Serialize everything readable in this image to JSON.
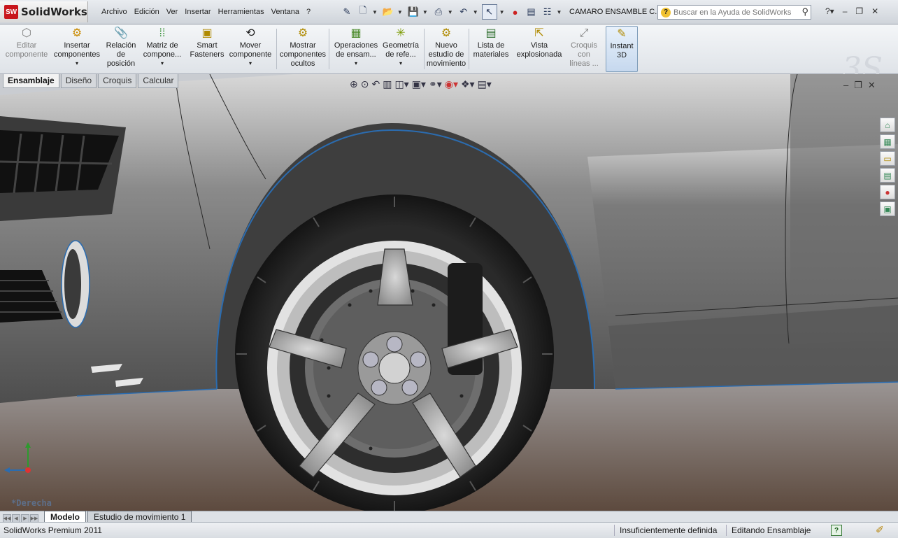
{
  "app": {
    "logo_text_prefix": "SW",
    "logo_text": "SolidWorks",
    "document_title": "CAMARO ENSAMBLE C..."
  },
  "menu": [
    "Archivo",
    "Edición",
    "Ver",
    "Insertar",
    "Herramientas",
    "Ventana",
    "?"
  ],
  "search": {
    "placeholder": "Buscar en la Ayuda de SolidWorks"
  },
  "ribbon": [
    {
      "label": "Editar\ncomponente",
      "icon": "edit-component-icon",
      "enabled": false
    },
    {
      "label": "Insertar\ncomponentes",
      "icon": "insert-components-icon",
      "enabled": true
    },
    {
      "label": "Relación\nde\nposición",
      "icon": "mate-icon",
      "enabled": true
    },
    {
      "label": "Matriz de\ncompone...",
      "icon": "component-pattern-icon",
      "enabled": true
    },
    {
      "label": "Smart\nFasteners",
      "icon": "smart-fasteners-icon",
      "enabled": true
    },
    {
      "label": "Mover\ncomponente",
      "icon": "move-component-icon",
      "enabled": true
    },
    {
      "label": "Mostrar\ncomponentes\nocultos",
      "icon": "show-hidden-icon",
      "enabled": true
    },
    {
      "label": "Operaciones\nde ensam...",
      "icon": "assembly-features-icon",
      "enabled": true
    },
    {
      "label": "Geometría\nde refe...",
      "icon": "reference-geometry-icon",
      "enabled": true
    },
    {
      "label": "Nuevo\nestudio de\nmovimiento",
      "icon": "new-motion-study-icon",
      "enabled": true
    },
    {
      "label": "Lista de\nmateriales",
      "icon": "bill-of-materials-icon",
      "enabled": true
    },
    {
      "label": "Vista\nexplosionada",
      "icon": "exploded-view-icon",
      "enabled": true
    },
    {
      "label": "Croquis\ncon\nlíneas ...",
      "icon": "explode-line-sketch-icon",
      "enabled": false
    },
    {
      "label": "Instant\n3D",
      "icon": "instant3d-icon",
      "enabled": true,
      "active": true
    }
  ],
  "command_tabs": [
    "Ensamblaje",
    "Diseño",
    "Croquis",
    "Calcular"
  ],
  "view_orientation": "*Derecha",
  "bottom_tabs": [
    "Modelo",
    "Estudio de movimiento 1"
  ],
  "status": {
    "product": "SolidWorks Premium 2011",
    "definition": "Insuficientemente definida",
    "mode": "Editando Ensamblaje"
  },
  "colors": {
    "accent": "#2b6cb0",
    "ground_top": "#8f8b8a",
    "ground_bottom": "#5a4a40",
    "body_paint": "#6b6b6b"
  }
}
